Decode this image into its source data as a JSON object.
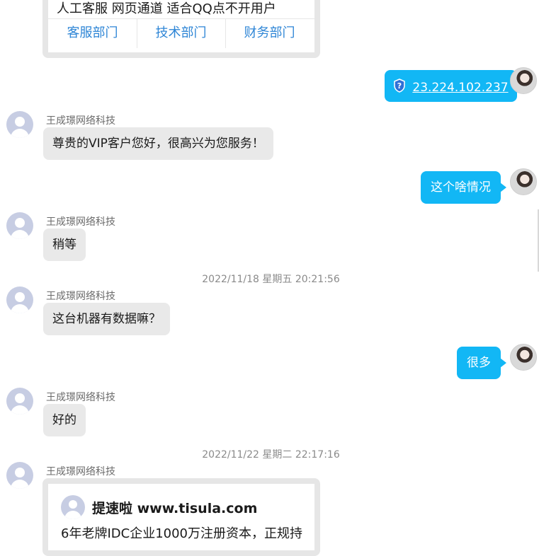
{
  "top_card": {
    "title": "人工客服 网页通道 适合QQ点不开用户",
    "buttons": [
      "客服部门",
      "技术部门",
      "财务部门"
    ]
  },
  "sender_name": "王成璟网络科技",
  "messages": {
    "ip_link": "23.224.102.237",
    "greeting": "尊贵的VIP客户您好，很高兴为您服务！",
    "question1": "这个啥情况",
    "wait": "稍等",
    "question2": "这台机器有数据嘛？",
    "answer": "很多",
    "ok": "好的"
  },
  "timestamps": [
    "2022/11/18 星期五 20:21:56",
    "2022/11/22 星期二 22:17:16"
  ],
  "bottom_card": {
    "title": "提速啦 www.tisula.com",
    "text": "6年老牌IDC企业1000万注册资本，正规持"
  },
  "colors": {
    "self_bubble": "#12b7f5",
    "other_bubble": "#e9e9e9",
    "link_blue": "#2f86d6"
  }
}
